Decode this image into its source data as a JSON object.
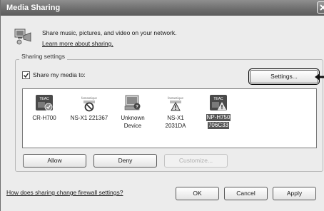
{
  "window": {
    "title": "Media Sharing"
  },
  "header": {
    "description": "Share music, pictures, and video on your network.",
    "learn_more_link": "Learn more about sharing."
  },
  "sharing_settings": {
    "group_label": "Sharing settings",
    "share_checkbox_label": "Share my media to:",
    "share_checked": true,
    "settings_button": "Settings..."
  },
  "devices": [
    {
      "label_line1": "CR-H700",
      "label_line2": "",
      "icon": "teac-device-allowed-icon",
      "selected": false
    },
    {
      "label_line1": "NS-X1 221367",
      "label_line2": "",
      "icon": "denied-device-icon",
      "selected": false
    },
    {
      "label_line1": "Unknown",
      "label_line2": "Device",
      "icon": "unknown-device-icon",
      "selected": false
    },
    {
      "label_line1": "NS-X1",
      "label_line2": "2031DA",
      "icon": "warning-device-icon",
      "selected": false
    },
    {
      "label_line1": "NP-H750",
      "label_line2": "706C33",
      "icon": "teac-device-warning-icon",
      "selected": true
    }
  ],
  "device_buttons": {
    "allow": "Allow",
    "deny": "Deny",
    "customize": "Customize..."
  },
  "footer": {
    "firewall_link": "How does sharing change firewall settings?",
    "ok": "OK",
    "cancel": "Cancel",
    "apply": "Apply"
  },
  "colors": {
    "titlebar": "#6f6f6f",
    "selection": "#555555",
    "window_bg": "#ececec"
  }
}
